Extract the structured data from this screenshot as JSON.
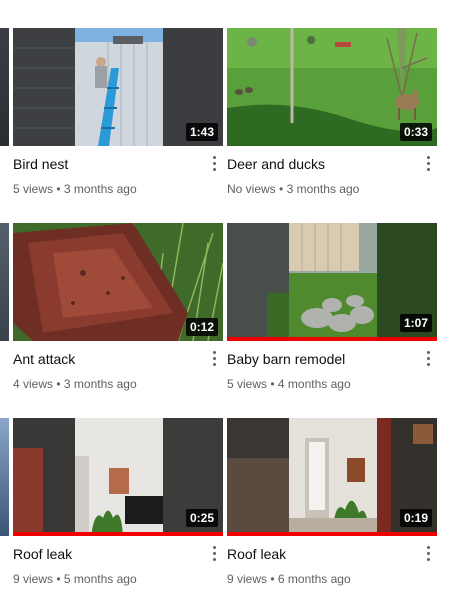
{
  "videos": [
    {
      "title": "Bird nest",
      "views": "5 views",
      "age": "3 months ago",
      "duration": "1:43",
      "watched": false,
      "thumb_icon": "bird-nest-thumbnail"
    },
    {
      "title": "Deer and ducks",
      "views": "No views",
      "age": "3 months ago",
      "duration": "0:33",
      "watched": false,
      "thumb_icon": "deer-ducks-thumbnail"
    },
    {
      "title": "Ant attack",
      "views": "4 views",
      "age": "3 months ago",
      "duration": "0:12",
      "watched": false,
      "thumb_icon": "ant-attack-thumbnail"
    },
    {
      "title": "Baby barn remodel",
      "views": "5 views",
      "age": "4 months ago",
      "duration": "1:07",
      "watched": true,
      "thumb_icon": "barn-thumbnail"
    },
    {
      "title": "Roof leak",
      "views": "9 views",
      "age": "5 months ago",
      "duration": "0:25",
      "watched": true,
      "thumb_icon": "roof-leak-thumbnail"
    },
    {
      "title": "Roof leak",
      "views": "9 views",
      "age": "6 months ago",
      "duration": "0:19",
      "watched": true,
      "thumb_icon": "roof-leak-thumbnail"
    }
  ],
  "separator": "•",
  "colors": {
    "progress": "#ee0000",
    "title": "#0f0f0f",
    "meta": "#606060"
  }
}
